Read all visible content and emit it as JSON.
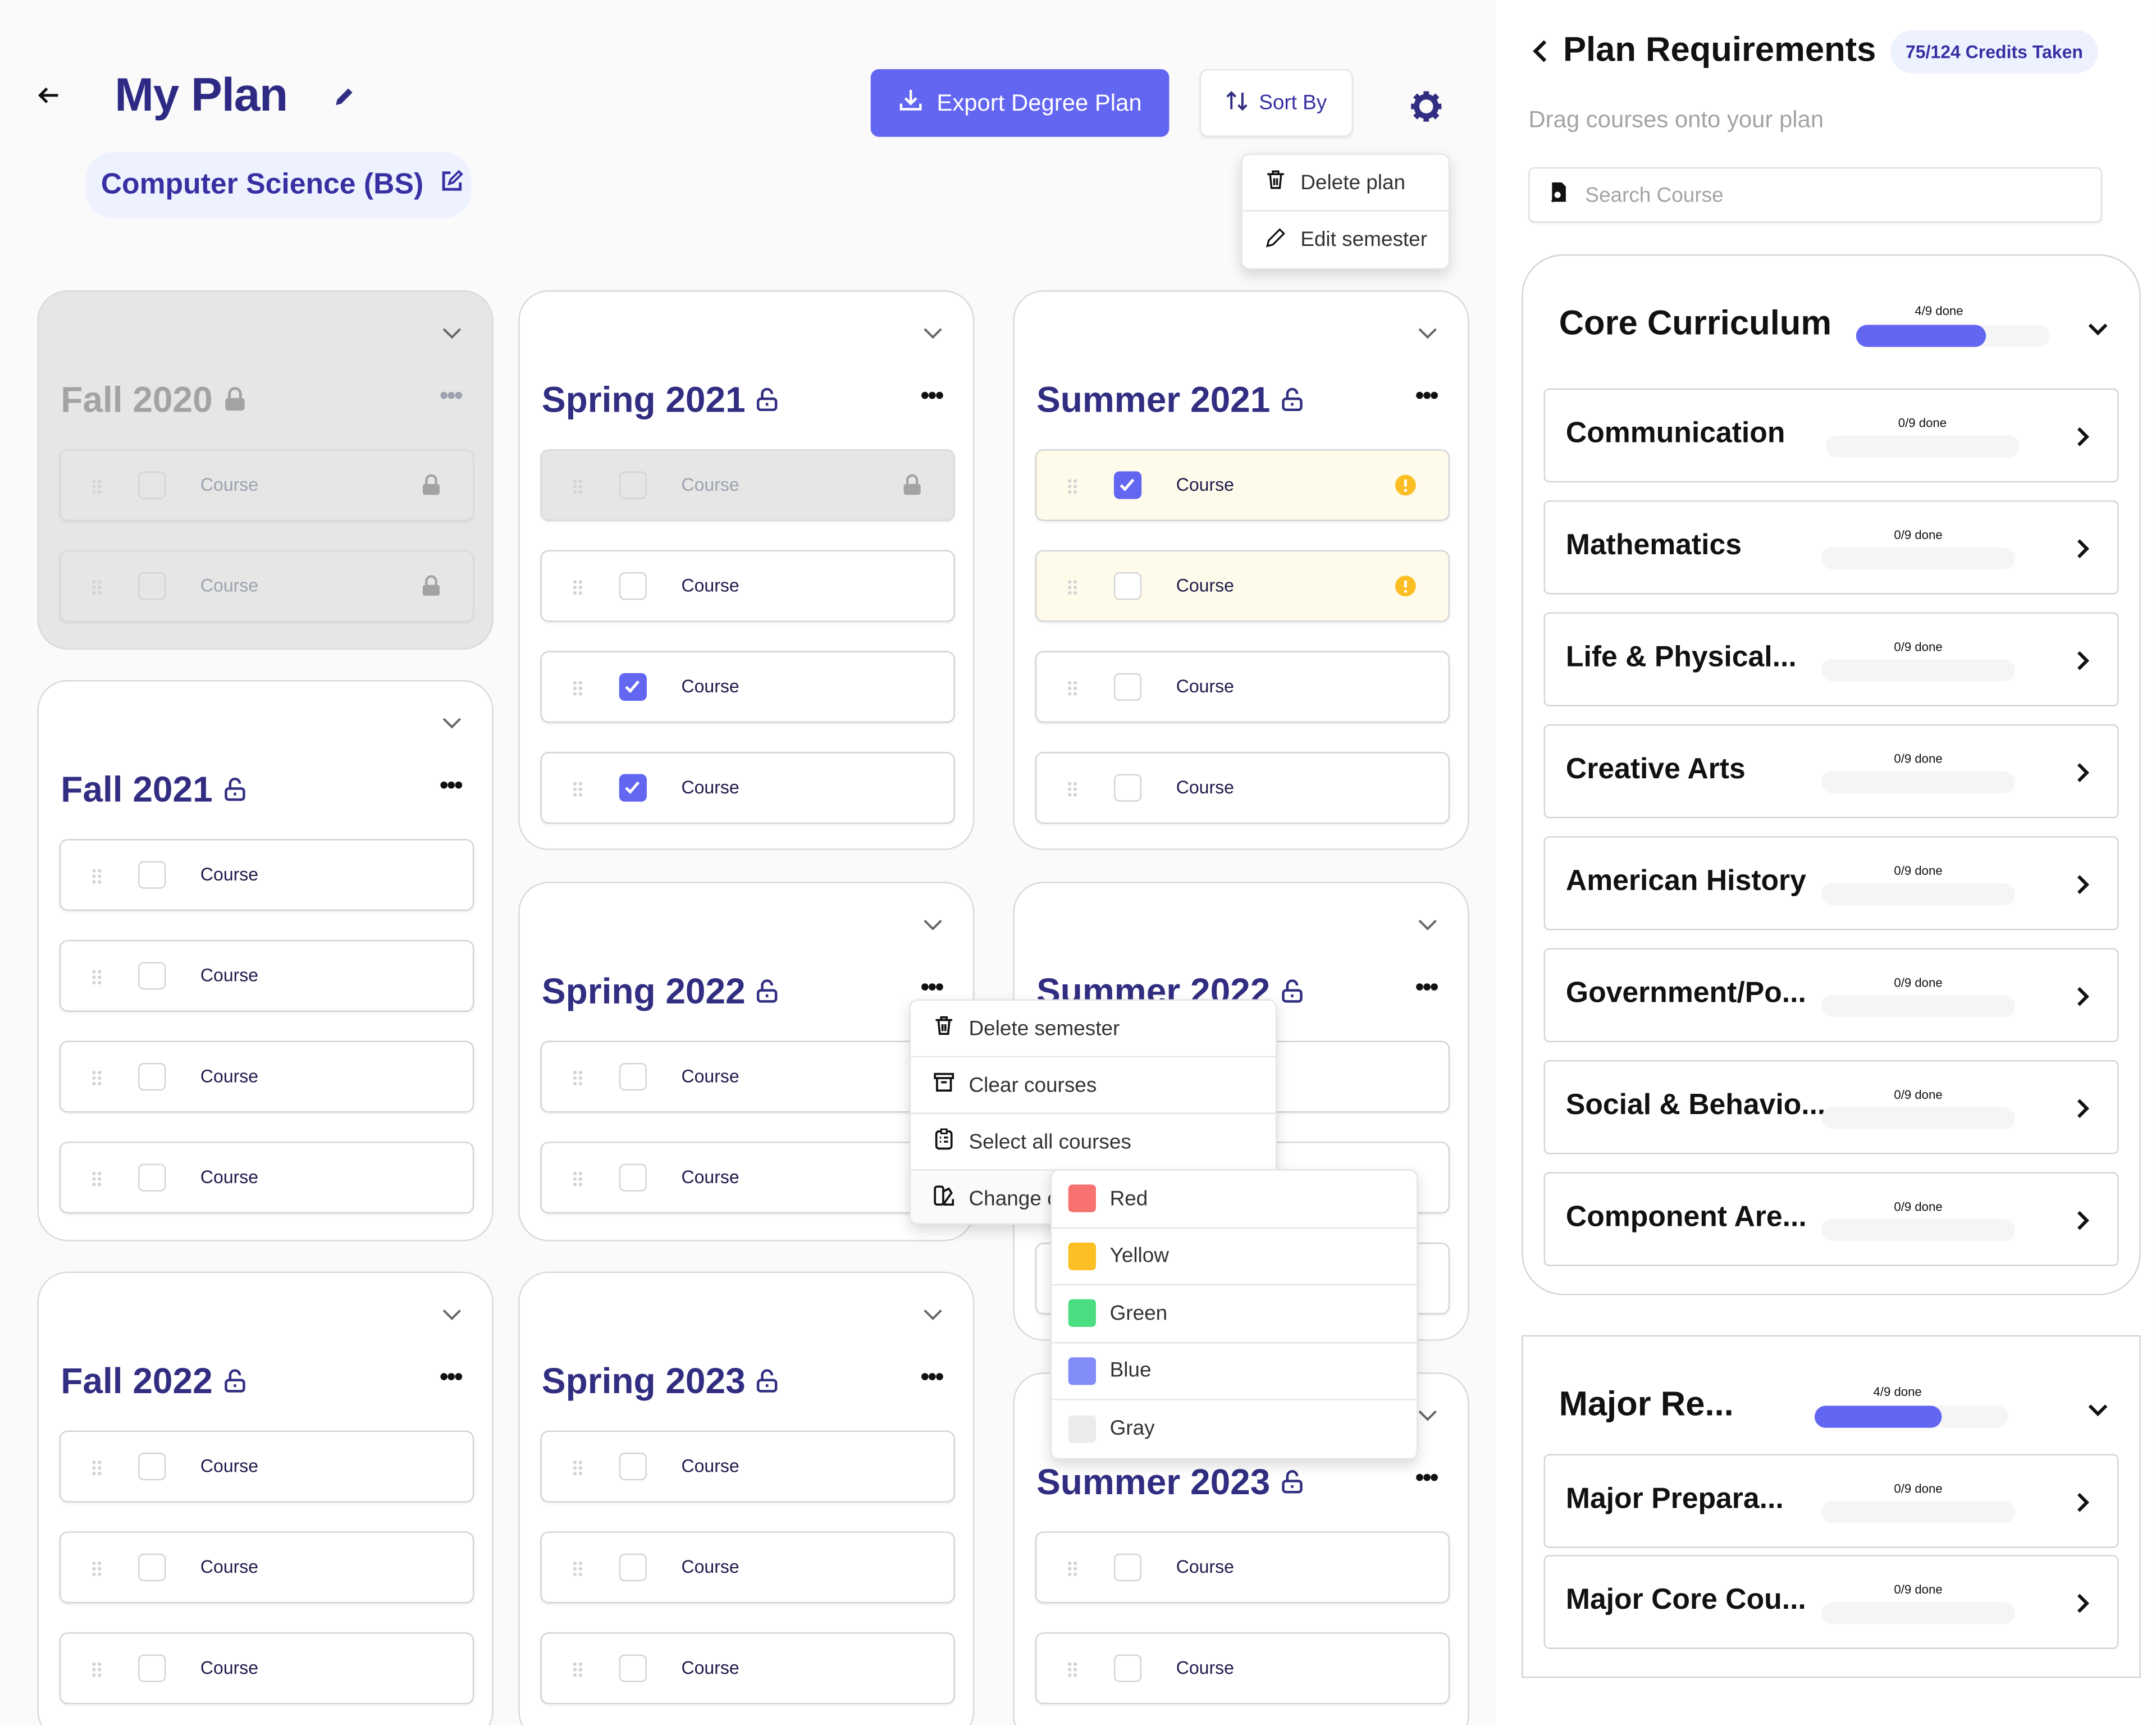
{
  "header": {
    "title": "My Plan",
    "program": "Computer Science (BS)",
    "export_label": "Export Degree Plan",
    "sort_label": "Sort By"
  },
  "plan_menu": {
    "items": [
      "Delete plan",
      "Edit semester"
    ]
  },
  "semesters": [
    {
      "name": "Fall 2020",
      "locked": true,
      "courses": [
        {
          "label": "Course",
          "checked": false,
          "locked": true
        },
        {
          "label": "Course",
          "checked": false,
          "locked": true
        }
      ]
    },
    {
      "name": "Spring 2021",
      "locked": false,
      "courses": [
        {
          "label": "Course",
          "checked": false,
          "locked": true
        },
        {
          "label": "Course",
          "checked": false
        },
        {
          "label": "Course",
          "checked": true
        },
        {
          "label": "Course",
          "checked": true
        }
      ]
    },
    {
      "name": "Summer 2021",
      "locked": false,
      "courses": [
        {
          "label": "Course",
          "checked": true,
          "highlight": "yellow",
          "warning": true
        },
        {
          "label": "Course",
          "checked": false,
          "highlight": "yellow",
          "warning": true
        },
        {
          "label": "Course",
          "checked": false
        },
        {
          "label": "Course",
          "checked": false
        }
      ]
    },
    {
      "name": "Fall 2021",
      "locked": false,
      "courses": [
        {
          "label": "Course",
          "checked": false
        },
        {
          "label": "Course",
          "checked": false
        },
        {
          "label": "Course",
          "checked": false
        },
        {
          "label": "Course",
          "checked": false
        }
      ]
    },
    {
      "name": "Spring 2022",
      "locked": false,
      "courses": [
        {
          "label": "Course",
          "checked": false
        },
        {
          "label": "Course",
          "checked": false
        }
      ]
    },
    {
      "name": "Summer 2022",
      "locked": false,
      "courses": [
        {
          "checked": false
        },
        {
          "checked": false
        },
        {
          "checked": false
        }
      ]
    },
    {
      "name": "Fall 2022",
      "locked": false,
      "courses": [
        {
          "label": "Course",
          "checked": false
        },
        {
          "label": "Course",
          "checked": false
        },
        {
          "label": "Course",
          "checked": false
        }
      ]
    },
    {
      "name": "Spring 2023",
      "locked": false,
      "courses": [
        {
          "label": "Course",
          "checked": false
        },
        {
          "label": "Course",
          "checked": false
        },
        {
          "label": "Course",
          "checked": false
        }
      ]
    },
    {
      "name": "Summer 2023",
      "locked": false,
      "courses": [
        {
          "label": "Course",
          "checked": false
        },
        {
          "label": "Course",
          "checked": false
        }
      ]
    }
  ],
  "semester_menu": {
    "items": [
      "Delete semester",
      "Clear courses",
      "Select all courses",
      "Change color"
    ],
    "colors": [
      {
        "label": "Red",
        "hex": "#f87171"
      },
      {
        "label": "Yellow",
        "hex": "#fbbf24"
      },
      {
        "label": "Green",
        "hex": "#4ade80"
      },
      {
        "label": "Blue",
        "hex": "#818cf8"
      },
      {
        "label": "Gray",
        "hex": "#ececec"
      }
    ]
  },
  "requirements": {
    "title": "Plan Requirements",
    "credits_badge": "75/124 Credits Taken",
    "subtitle": "Drag courses onto your plan",
    "search_placeholder": "Search Course",
    "groups": [
      {
        "name": "Core Curriculum",
        "progress_label": "4/9 done",
        "fill_percent": 67,
        "items": [
          {
            "name": "Communication",
            "progress_label": "0/9 done",
            "fill_percent": 0
          },
          {
            "name": "Mathematics",
            "progress_label": "0/9 done",
            "fill_percent": 0
          },
          {
            "name": "Life & Physical...",
            "progress_label": "0/9 done",
            "fill_percent": 0
          },
          {
            "name": "Creative Arts",
            "progress_label": "0/9 done",
            "fill_percent": 0
          },
          {
            "name": "American History",
            "progress_label": "0/9 done",
            "fill_percent": 0
          },
          {
            "name": "Government/Po...",
            "progress_label": "0/9 done",
            "fill_percent": 0
          },
          {
            "name": "Social & Behavio...",
            "progress_label": "0/9 done",
            "fill_percent": 0
          },
          {
            "name": "Component Are...",
            "progress_label": "0/9 done",
            "fill_percent": 0
          }
        ]
      },
      {
        "name": "Major  Re...",
        "progress_label": "4/9 done",
        "fill_percent": 66,
        "items": [
          {
            "name": "Major Prepara...",
            "progress_label": "0/9 done",
            "fill_percent": 0
          },
          {
            "name": "Major Core Cou...",
            "progress_label": "0/9 done",
            "fill_percent": 0
          }
        ]
      }
    ]
  },
  "colors": {
    "accent": "#6366f1",
    "title": "#312e81",
    "warning": "#fbbf24"
  }
}
